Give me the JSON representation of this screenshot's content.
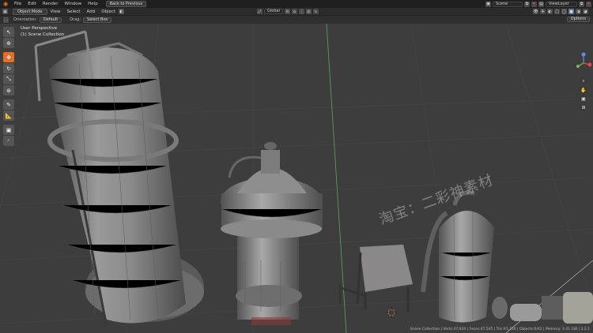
{
  "topbar": {
    "menus": [
      "File",
      "Edit",
      "Render",
      "Window",
      "Help"
    ],
    "back_button": "Back to Previous",
    "scene": "Scene",
    "view_layer": "ViewLayer"
  },
  "header": {
    "mode": "Object Mode",
    "menus": [
      "View",
      "Select",
      "Add",
      "Object"
    ],
    "transform_orientation": "Global"
  },
  "tool_settings": {
    "orientation_label": "Orientation:",
    "orientation_value": "Default",
    "drag_label": "Drag:",
    "drag_value": "Select Box",
    "options_label": "Options"
  },
  "viewport": {
    "view_name": "User Perspective",
    "collection": "(1) Scene Collection",
    "watermark": "淘宝：二彩神素材"
  },
  "statusbar": {
    "text": "Scene Collection | Verts:47,920 | Faces:47,545 | Tris:91,356 | Objects:0/42 | Memory: 3.41 GiB | 3.2.1"
  },
  "tools": [
    "cursor-tool",
    "select-tool",
    "move-tool",
    "rotate-tool",
    "scale-tool",
    "transform-tool",
    "annotate-tool",
    "measure-tool",
    "add-cube-tool",
    "extra-tool"
  ]
}
